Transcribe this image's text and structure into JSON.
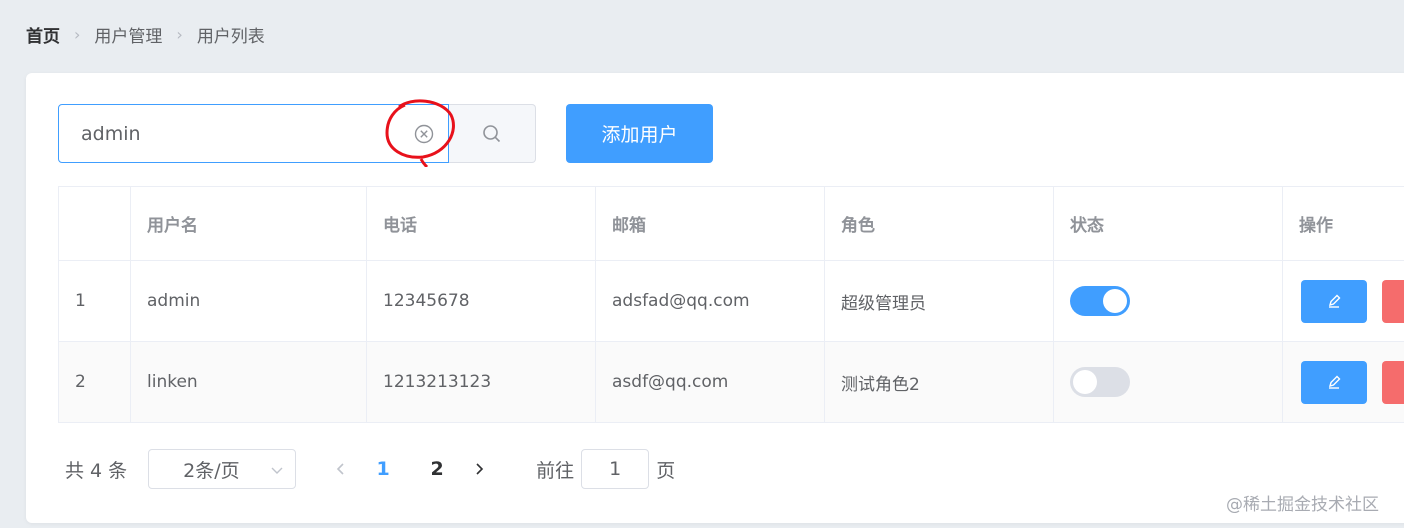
{
  "breadcrumb": {
    "home": "首页",
    "level1": "用户管理",
    "level2": "用户列表"
  },
  "search": {
    "value": "admin"
  },
  "toolbar": {
    "add_label": "添加用户"
  },
  "table": {
    "headers": [
      "",
      "用户名",
      "电话",
      "邮箱",
      "角色",
      "状态",
      "操作"
    ],
    "rows": [
      {
        "index": "1",
        "username": "admin",
        "phone": "12345678",
        "email": "adsfad@qq.com",
        "role": "超级管理员",
        "status_on": true
      },
      {
        "index": "2",
        "username": "linken",
        "phone": "1213213123",
        "email": "asdf@qq.com",
        "role": "测试角色2",
        "status_on": false
      }
    ]
  },
  "pagination": {
    "total_label": "共 4 条",
    "page_size_label": "2条/页",
    "pages": [
      "1",
      "2"
    ],
    "current_page": "1",
    "goto_label": "前往",
    "goto_value": "1",
    "page_unit": "页"
  },
  "watermark": "@稀土掘金技术社区",
  "colors": {
    "primary": "#409eff",
    "danger": "#f56c6c",
    "annotation": "#e8111b"
  }
}
